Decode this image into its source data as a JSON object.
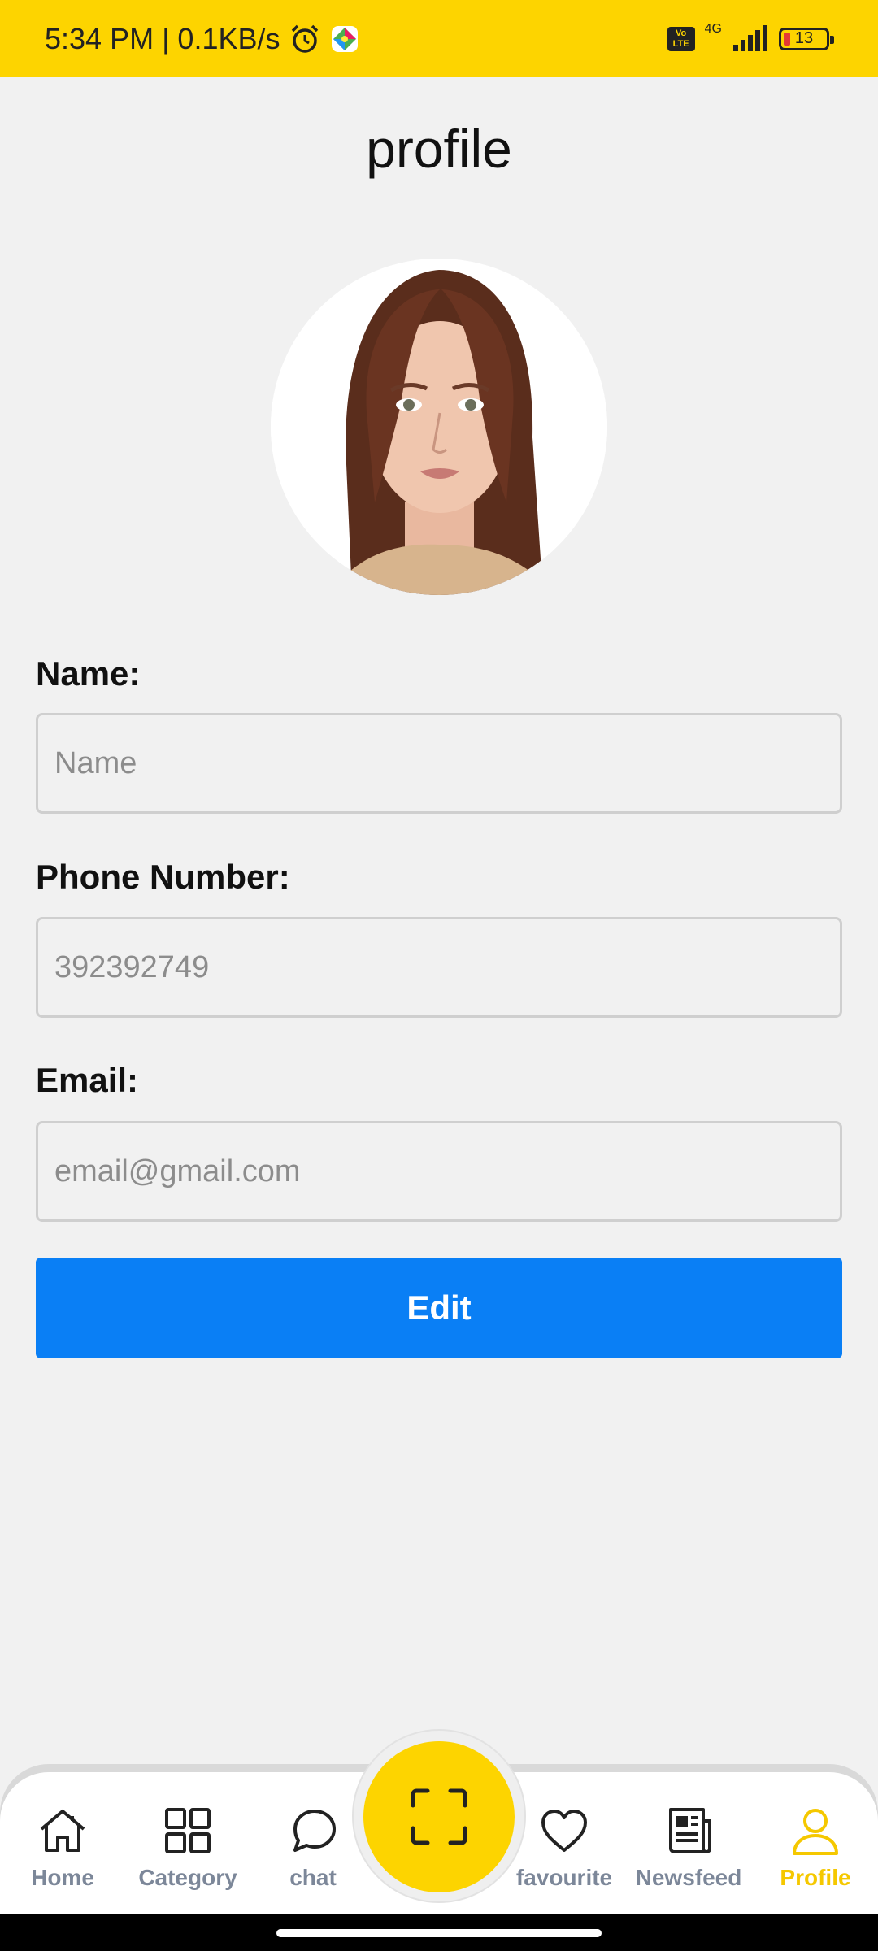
{
  "status_bar": {
    "time": "5:34 PM",
    "speed": "| 0.1KB/s",
    "network": "4G",
    "volte": "Vo LTE",
    "battery": "13",
    "icons": [
      "alarm-icon",
      "app-icon",
      "signal-icon",
      "battery-icon"
    ]
  },
  "page": {
    "title": "profile"
  },
  "form": {
    "name_label": "Name:",
    "name_placeholder": "Name",
    "phone_label": "Phone Number:",
    "phone_placeholder": "392392749",
    "email_label": "Email:",
    "email_placeholder": "email@gmail.com",
    "edit_label": "Edit"
  },
  "nav": {
    "items": [
      {
        "label": "Home",
        "icon": "home-icon"
      },
      {
        "label": "Category",
        "icon": "grid-icon"
      },
      {
        "label": "chat",
        "icon": "chat-icon"
      },
      {
        "label": "favourite",
        "icon": "heart-icon"
      },
      {
        "label": "Newsfeed",
        "icon": "newspaper-icon"
      },
      {
        "label": "Profile",
        "icon": "user-icon"
      }
    ],
    "active": "Profile",
    "scan_icon": "scan-icon"
  },
  "colors": {
    "accent": "#fdd400",
    "button": "#0a7ff5",
    "nav_inactive": "#7c8799",
    "background": "#f1f1f1"
  }
}
